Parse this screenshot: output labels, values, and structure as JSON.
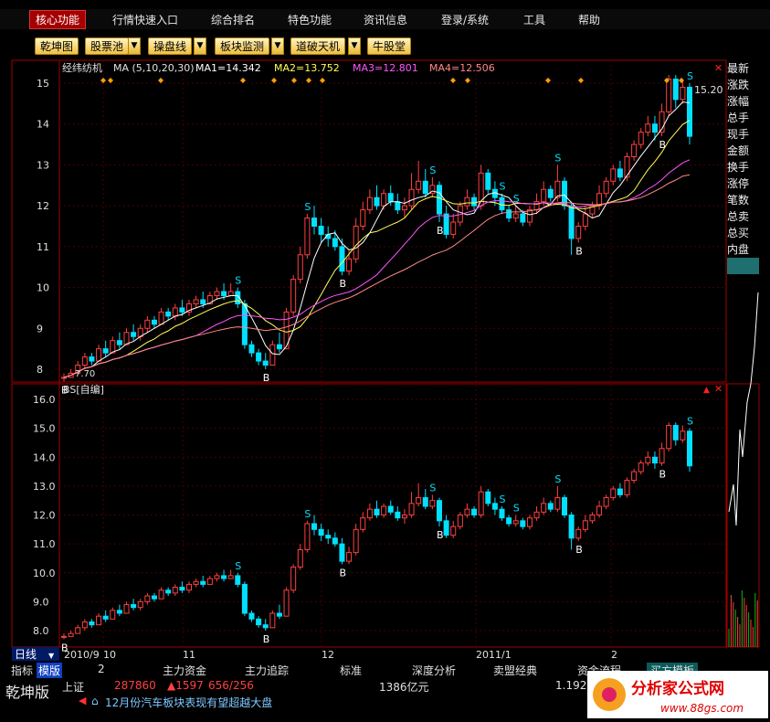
{
  "menu": {
    "items": [
      "核心功能",
      "行情快速入口",
      "综合排名",
      "特色功能",
      "资讯信息",
      "登录/系统",
      "工具",
      "帮助"
    ]
  },
  "toolbar": {
    "buttons": [
      "乾坤图",
      "股票池",
      "操盘线",
      "板块监测",
      "道破天机",
      "牛股堂"
    ]
  },
  "sidebar": {
    "items": [
      "最新",
      "涨跌",
      "涨幅",
      "总手",
      "现手",
      "金额",
      "换手",
      "涨停",
      "笔数",
      "总卖",
      "总买",
      "内盘"
    ]
  },
  "main_chart": {
    "stock_name": "经纬纺机",
    "ma_header": "MA (5,10,20,30)",
    "ma1": "MA1=14.342",
    "ma2": "MA2=13.752",
    "ma3": "MA3=12.801",
    "ma4": "MA4=12.506",
    "last_price": "15.20",
    "low_marker": "7.70",
    "y_ticks": [
      "15",
      "14",
      "13",
      "12",
      "11",
      "10",
      "9",
      "8"
    ],
    "colors": {
      "ma1": "#ffffff",
      "ma2": "#ffff55",
      "ma3": "#ff55ff",
      "ma4": "#ff8888",
      "up": "#ff4040",
      "down": "#00e0ff"
    }
  },
  "sub_chart": {
    "title": "BS[自编]",
    "y_ticks": [
      "16.0",
      "15.0",
      "14.0",
      "13.0",
      "12.0",
      "11.0",
      "10.0",
      "9.0",
      "8.0"
    ]
  },
  "x_axis": {
    "period": "日线",
    "labels": [
      "2010/9",
      "10",
      "11",
      "12",
      "2011/1",
      "2"
    ]
  },
  "bottom_tabs": [
    "指标",
    "模版",
    "2",
    "主力资金",
    "主力追踪",
    "标准",
    "深度分析",
    "卖盟经典",
    "资金流程",
    "买方模板"
  ],
  "status": {
    "brand": "乾坤版",
    "index_name": "上证",
    "value1": "287860",
    "change": "▲1597",
    "updown": "656/256",
    "amount": "1386亿元",
    "extra": "1.192",
    "news": "12月份汽车板块表现有望超越大盘"
  },
  "watermark": {
    "text": "分析家公式网",
    "url": "www.88gs.com"
  },
  "candles": [
    [
      7.8,
      7.8,
      7.9,
      7.7
    ],
    [
      7.8,
      7.9,
      8.0,
      7.8
    ],
    [
      7.9,
      8.1,
      8.2,
      7.9
    ],
    [
      8.1,
      8.3,
      8.4,
      8.0
    ],
    [
      8.3,
      8.2,
      8.4,
      8.1
    ],
    [
      8.2,
      8.5,
      8.6,
      8.2
    ],
    [
      8.5,
      8.4,
      8.7,
      8.3
    ],
    [
      8.4,
      8.7,
      8.8,
      8.4
    ],
    [
      8.7,
      8.6,
      8.9,
      8.5
    ],
    [
      8.6,
      8.9,
      9.0,
      8.6
    ],
    [
      8.9,
      8.8,
      9.1,
      8.7
    ],
    [
      8.8,
      9.0,
      9.1,
      8.7
    ],
    [
      9.0,
      9.2,
      9.3,
      8.9
    ],
    [
      9.2,
      9.1,
      9.3,
      9.0
    ],
    [
      9.1,
      9.4,
      9.5,
      9.1
    ],
    [
      9.4,
      9.3,
      9.5,
      9.2
    ],
    [
      9.3,
      9.5,
      9.6,
      9.2
    ],
    [
      9.5,
      9.4,
      9.7,
      9.3
    ],
    [
      9.4,
      9.6,
      9.7,
      9.3
    ],
    [
      9.6,
      9.7,
      9.8,
      9.5
    ],
    [
      9.7,
      9.6,
      9.9,
      9.5
    ],
    [
      9.6,
      9.8,
      9.9,
      9.6
    ],
    [
      9.8,
      9.9,
      10.0,
      9.7
    ],
    [
      9.9,
      9.8,
      10.1,
      9.7
    ],
    [
      9.8,
      9.9,
      10.1,
      9.8
    ],
    [
      9.9,
      9.6,
      10.0,
      9.5
    ],
    [
      9.6,
      8.6,
      9.7,
      8.5
    ],
    [
      8.6,
      8.4,
      8.7,
      8.3
    ],
    [
      8.4,
      8.2,
      8.5,
      8.1
    ],
    [
      8.2,
      8.1,
      8.4,
      8.0
    ],
    [
      8.1,
      8.6,
      8.7,
      8.1
    ],
    [
      8.6,
      8.5,
      8.9,
      8.4
    ],
    [
      8.5,
      9.4,
      9.5,
      8.5
    ],
    [
      9.4,
      10.2,
      10.3,
      9.3
    ],
    [
      10.2,
      10.8,
      11.0,
      10.1
    ],
    [
      10.8,
      11.7,
      11.8,
      10.7
    ],
    [
      11.7,
      11.5,
      12.0,
      11.3
    ],
    [
      11.5,
      11.3,
      11.7,
      11.1
    ],
    [
      11.3,
      11.2,
      11.5,
      11.0
    ],
    [
      11.2,
      11.0,
      11.4,
      10.9
    ],
    [
      11.0,
      10.4,
      11.2,
      10.3
    ],
    [
      10.4,
      10.7,
      10.9,
      10.3
    ],
    [
      10.7,
      11.5,
      11.7,
      10.6
    ],
    [
      11.5,
      11.9,
      12.1,
      11.4
    ],
    [
      11.9,
      12.2,
      12.4,
      11.8
    ],
    [
      12.2,
      12.0,
      12.5,
      11.9
    ],
    [
      12.0,
      12.3,
      12.4,
      11.9
    ],
    [
      12.3,
      12.1,
      12.5,
      12.0
    ],
    [
      12.1,
      11.9,
      12.3,
      11.8
    ],
    [
      11.9,
      12.0,
      12.2,
      11.7
    ],
    [
      12.0,
      12.4,
      12.8,
      11.9
    ],
    [
      12.4,
      12.6,
      13.1,
      12.3
    ],
    [
      12.6,
      12.3,
      12.9,
      12.2
    ],
    [
      12.3,
      12.5,
      12.7,
      12.2
    ],
    [
      12.5,
      11.8,
      12.6,
      11.6
    ],
    [
      11.8,
      11.3,
      12.0,
      11.2
    ],
    [
      11.3,
      11.6,
      11.8,
      11.2
    ],
    [
      11.6,
      12.0,
      12.1,
      11.5
    ],
    [
      12.0,
      12.2,
      12.4,
      11.9
    ],
    [
      12.2,
      12.0,
      12.3,
      11.9
    ],
    [
      12.0,
      12.8,
      13.0,
      11.9
    ],
    [
      12.8,
      12.4,
      12.9,
      12.3
    ],
    [
      12.4,
      12.2,
      12.6,
      12.0
    ],
    [
      12.2,
      11.9,
      12.3,
      11.8
    ],
    [
      11.9,
      11.7,
      12.0,
      11.6
    ],
    [
      11.7,
      11.8,
      12.0,
      11.6
    ],
    [
      11.8,
      11.6,
      11.9,
      11.5
    ],
    [
      11.6,
      11.9,
      12.0,
      11.5
    ],
    [
      11.9,
      12.1,
      12.3,
      11.8
    ],
    [
      12.1,
      12.4,
      12.6,
      12.0
    ],
    [
      12.4,
      12.2,
      12.5,
      12.1
    ],
    [
      12.2,
      12.6,
      13.0,
      12.1
    ],
    [
      12.6,
      12.0,
      12.7,
      11.9
    ],
    [
      12.0,
      11.2,
      12.1,
      10.8
    ],
    [
      11.2,
      11.5,
      11.6,
      11.1
    ],
    [
      11.5,
      11.8,
      12.0,
      11.4
    ],
    [
      11.8,
      12.0,
      12.1,
      11.7
    ],
    [
      12.0,
      12.3,
      12.5,
      11.9
    ],
    [
      12.3,
      12.6,
      12.7,
      12.2
    ],
    [
      12.6,
      12.9,
      13.0,
      12.5
    ],
    [
      12.9,
      12.7,
      13.1,
      12.6
    ],
    [
      12.7,
      13.2,
      13.3,
      12.6
    ],
    [
      13.2,
      13.5,
      13.6,
      13.1
    ],
    [
      13.5,
      13.8,
      13.9,
      13.4
    ],
    [
      13.8,
      14.0,
      14.2,
      13.7
    ],
    [
      14.0,
      13.8,
      14.2,
      13.6
    ],
    [
      13.8,
      14.3,
      14.5,
      13.7
    ],
    [
      14.3,
      15.1,
      15.2,
      14.2
    ],
    [
      15.1,
      14.6,
      15.2,
      14.4
    ],
    [
      14.6,
      14.9,
      15.1,
      14.5
    ],
    [
      14.9,
      13.7,
      15.0,
      13.5
    ]
  ]
}
